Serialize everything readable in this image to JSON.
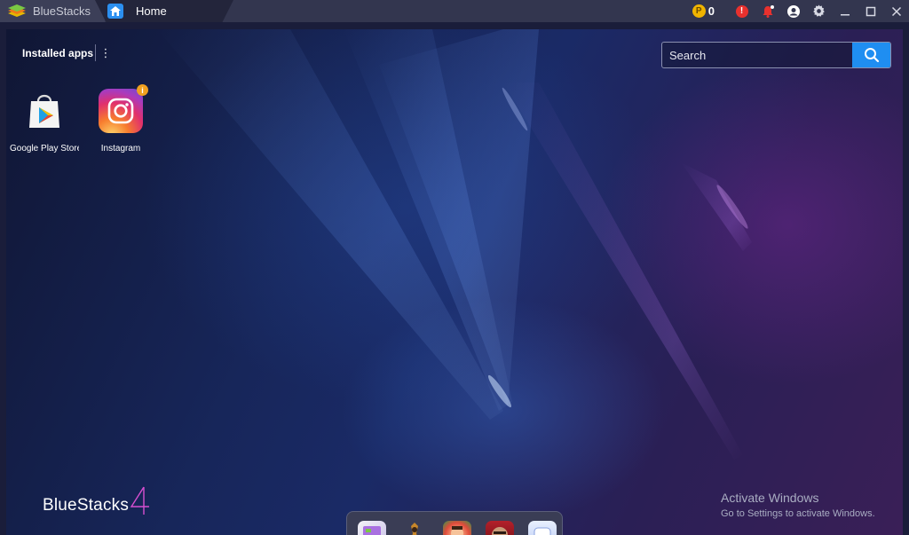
{
  "titlebar": {
    "brand_name": "BlueStacks",
    "home_tab_label": "Home",
    "coin_symbol": "P",
    "coin_count": "0",
    "alert_symbol": "!"
  },
  "sidebar": {
    "installed_label": "Installed apps",
    "more_symbol": "⋮"
  },
  "search": {
    "placeholder": "Search"
  },
  "apps": [
    {
      "name": "Google Play Store"
    },
    {
      "name": "Instagram",
      "badge": "i"
    }
  ],
  "logo": {
    "text": "BlueStacks",
    "version": "4"
  },
  "watermark": {
    "title": "Activate Windows",
    "subtitle": "Go to Settings to activate Windows."
  },
  "dock": {
    "icons": [
      "app-icon",
      "game-icon",
      "game-icon",
      "game-icon",
      "app-icon"
    ]
  },
  "colors": {
    "accent": "#1f8ef1",
    "titlebar": "#33364f",
    "alert": "#e8312e",
    "coin": "#f0b400"
  }
}
